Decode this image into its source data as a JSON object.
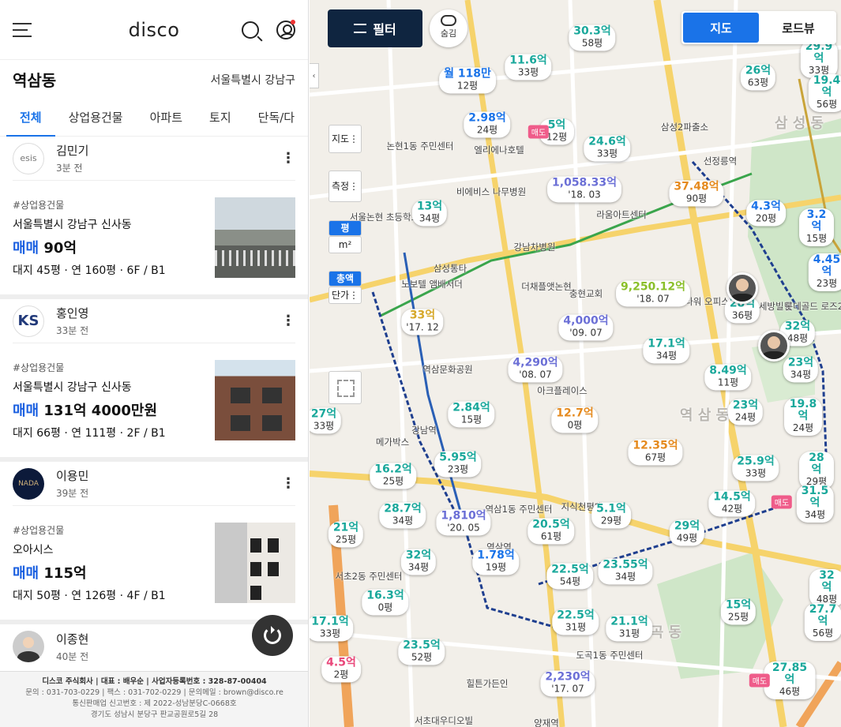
{
  "app": {
    "logo": "disco"
  },
  "location": {
    "name": "역삼동",
    "region": "서울특별시 강남구"
  },
  "tabs": [
    "전체",
    "상업용건물",
    "아파트",
    "토지",
    "단독/다"
  ],
  "listings": [
    {
      "avatar_text": "esis",
      "agent": "김민기",
      "time": "3분 전",
      "category": "#상업용건물",
      "address": "서울특별시 강남구 신사동",
      "deal": "매매",
      "price": "90억",
      "meta": "대지 45평 · 연 160평 · 6F / B1"
    },
    {
      "avatar_text": "KS",
      "agent": "홍인영",
      "time": "33분 전",
      "category": "#상업용건물",
      "address": "서울특별시 강남구 신사동",
      "deal": "매매",
      "price": "131억 4000만원",
      "meta": "대지 66평 · 연 111평 · 2F / B1"
    },
    {
      "avatar_text": "NADA",
      "agent": "이용민",
      "time": "39분 전",
      "category": "#상업용건물",
      "address": "오아시스",
      "deal": "매매",
      "price": "115억",
      "meta": "대지 50평 · 연 126평 · 4F / B1"
    },
    {
      "avatar_text": "",
      "agent": "이종현",
      "time": "40분 전"
    }
  ],
  "footer": {
    "line1": "디스코 주식회사 | 대표 : 배우순 | 사업자등록번호 : 328-87-00404",
    "line2": "문의 : 031-703-0229 | 팩스 : 031-702-0229 | 문의메일 : brown@disco.re",
    "line3": "통신판매업 신고번호 : 제 2022-성남분당C-0668호",
    "line4": "경기도 성남시 분당구 판교공원로5길 28"
  },
  "map_controls": {
    "filter": "필터",
    "hide": "숨김",
    "view_map": "지도",
    "view_road": "로드뷰",
    "side_map": "지도",
    "side_measure": "측정",
    "unit_pyeong": "평",
    "unit_m2": "m²",
    "total": "총액",
    "unit_price": "단가"
  },
  "pins": [
    {
      "p": "30.3억",
      "s": "58평",
      "c": "teal"
    },
    {
      "p": "11.6억",
      "s": "33평",
      "c": "teal"
    },
    {
      "p": "월 118만",
      "s": "12평",
      "c": "blue"
    },
    {
      "p": "2.98억",
      "s": "24평",
      "c": "blue"
    },
    {
      "p": "5억",
      "s": "12평",
      "c": "teal"
    },
    {
      "p": "24.6억",
      "s": "33평",
      "c": "teal"
    },
    {
      "p": "1,058.33억",
      "s": "'18. 03",
      "c": "purple"
    },
    {
      "p": "37.48억",
      "s": "90평",
      "c": "orange"
    },
    {
      "p": "26억",
      "s": "63평",
      "c": "teal"
    },
    {
      "p": "29.9억",
      "s": "33평",
      "c": "teal"
    },
    {
      "p": "19.4억",
      "s": "56평",
      "c": "teal"
    },
    {
      "p": "13억",
      "s": "34평",
      "c": "teal"
    },
    {
      "p": "4.3억",
      "s": "20평",
      "c": "blue"
    },
    {
      "p": "3.2억",
      "s": "15평",
      "c": "blue"
    },
    {
      "p": "4.45억",
      "s": "23평",
      "c": "blue"
    },
    {
      "p": "9,250.12억",
      "s": "'18. 07",
      "c": "lime"
    },
    {
      "p": "28억",
      "s": "36평",
      "c": "teal"
    },
    {
      "p": "33억",
      "s": "'17. 12",
      "c": "yellow"
    },
    {
      "p": "4,000억",
      "s": "'09. 07",
      "c": "purple"
    },
    {
      "p": "17.1억",
      "s": "34평",
      "c": "teal"
    },
    {
      "p": "32억",
      "s": "48평",
      "c": "teal"
    },
    {
      "p": "4,290억",
      "s": "'08. 07",
      "c": "purple"
    },
    {
      "p": "8.49억",
      "s": "11평",
      "c": "teal"
    },
    {
      "p": "23억",
      "s": "34평",
      "c": "teal"
    },
    {
      "p": "2.84억",
      "s": "15평",
      "c": "teal"
    },
    {
      "p": "12.7억",
      "s": "0평",
      "c": "orange"
    },
    {
      "p": "23억",
      "s": "24평",
      "c": "teal"
    },
    {
      "p": "19.8억",
      "s": "24평",
      "c": "teal"
    },
    {
      "p": "27억",
      "s": "33평",
      "c": "teal"
    },
    {
      "p": "12.35억",
      "s": "67평",
      "c": "orange"
    },
    {
      "p": "5.95억",
      "s": "23평",
      "c": "teal"
    },
    {
      "p": "16.2억",
      "s": "25평",
      "c": "teal"
    },
    {
      "p": "25.9억",
      "s": "33평",
      "c": "teal"
    },
    {
      "p": "28억",
      "s": "29평",
      "c": "teal"
    },
    {
      "p": "14.5억",
      "s": "42평",
      "c": "teal"
    },
    {
      "p": "31.5억",
      "s": "34평",
      "c": "teal"
    },
    {
      "p": "28.7억",
      "s": "34평",
      "c": "teal"
    },
    {
      "p": "1,810억",
      "s": "'20. 05",
      "c": "purple"
    },
    {
      "p": "5.1억",
      "s": "29평",
      "c": "teal"
    },
    {
      "p": "20.5억",
      "s": "61평",
      "c": "teal"
    },
    {
      "p": "21억",
      "s": "25평",
      "c": "teal"
    },
    {
      "p": "29억",
      "s": "49평",
      "c": "teal"
    },
    {
      "p": "32억",
      "s": "34평",
      "c": "teal"
    },
    {
      "p": "1.78억",
      "s": "19평",
      "c": "blue"
    },
    {
      "p": "22.5억",
      "s": "54평",
      "c": "teal"
    },
    {
      "p": "23.55억",
      "s": "34평",
      "c": "teal"
    },
    {
      "p": "16.3억",
      "s": "0평",
      "c": "teal"
    },
    {
      "p": "32억",
      "s": "48평",
      "c": "teal"
    },
    {
      "p": "15억",
      "s": "25평",
      "c": "teal"
    },
    {
      "p": "27.7억",
      "s": "56평",
      "c": "teal"
    },
    {
      "p": "17.1억",
      "s": "33평",
      "c": "teal"
    },
    {
      "p": "22.5억",
      "s": "31평",
      "c": "teal"
    },
    {
      "p": "21.1억",
      "s": "31평",
      "c": "teal"
    },
    {
      "p": "23.5억",
      "s": "52평",
      "c": "teal"
    },
    {
      "p": "4.5억",
      "s": "2평",
      "c": "pink"
    },
    {
      "p": "2,230억",
      "s": "'17. 07",
      "c": "purple"
    },
    {
      "p": "27.85억",
      "s": "46평",
      "c": "teal"
    }
  ],
  "map_labels": [
    "선정릉역",
    "삼성2파출소",
    "논현1동 주민센터",
    "엘리에나호텔",
    "비에비스 나무병원",
    "서울논현 초등학교",
    "라움아트센터",
    "강남차병원",
    "삼성통타",
    "노보텔 앰배서더",
    "더채플앳논현",
    "충현교회",
    "역삼문화공원",
    "K타워 오피스텔",
    "세방빌딩",
    "롯데골드 로즈2차오피스",
    "아크플레이스",
    "강남역",
    "메가박스",
    "역삼1동 주민센터",
    "지식천평대",
    "서초2동 주민센터",
    "역삼역",
    "도곡1동 주민센터",
    "양재역",
    "서초대우디오빌",
    "힐튼가든인",
    "역 삼 동",
    "삼 성 동",
    "도 곡 동"
  ]
}
